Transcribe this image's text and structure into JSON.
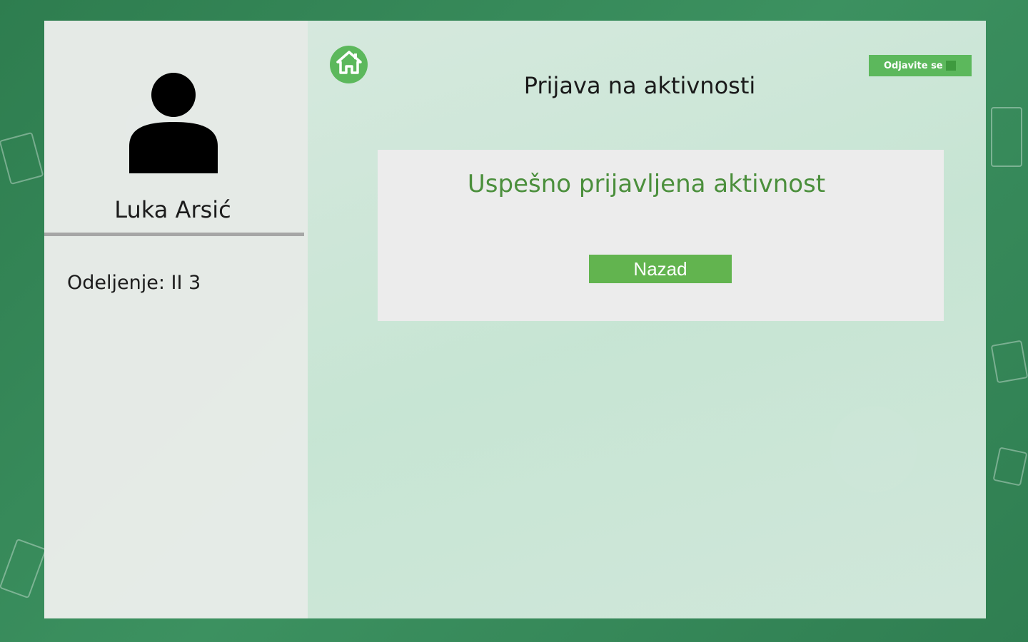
{
  "page": {
    "title": "Prijava na aktivnosti",
    "logout_label": "Odjavite se"
  },
  "sidebar": {
    "user_name": "Luka Arsić",
    "department": "Odeljenje: II 3"
  },
  "card": {
    "message": "Uspešno prijavljena aktivnost",
    "back_label": "Nazad"
  },
  "colors": {
    "accent_green": "#5cb85c",
    "message_green": "#4b8f3c",
    "background_green": "#3b8a5c"
  },
  "icons": {
    "home": "home-icon",
    "avatar": "user-avatar-icon"
  }
}
